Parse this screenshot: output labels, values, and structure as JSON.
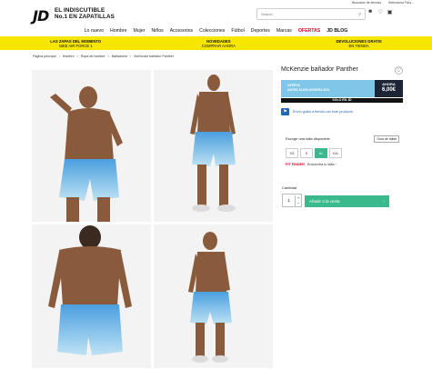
{
  "utility": {
    "links": [
      "Buscador de tiendas",
      "Selecciona País..."
    ]
  },
  "header": {
    "logo": "JD",
    "tagline_line1": "EL INDISCUTIBLE",
    "tagline_line2": "No.1 EN ZAPATILLAS",
    "search_placeholder": "Search",
    "icons": [
      "search-icon",
      "user-icon",
      "heart-icon",
      "bag-icon"
    ]
  },
  "nav": {
    "items": [
      "Lo nuevo",
      "Hombre",
      "Mujer",
      "Niños",
      "Accesorios",
      "Colecciones",
      "Fútbol",
      "Deportes",
      "Marcas"
    ],
    "offer": "OFERTAS",
    "blog": "JD BLOG"
  },
  "promo": [
    {
      "title": "LAS ZAPAS DEL MOMENTO",
      "sub": "NIKE AIR FORCE 1"
    },
    {
      "title": "NOVEDADES",
      "sub": "COMPRAR AHORA"
    },
    {
      "title": "DEVOLUCIONES GRATIS",
      "sub": "EN TIENDA"
    }
  ],
  "breadcrumb": [
    "Página principal",
    "Hombre",
    "Ropa de hombre",
    "Bañadores",
    "McKenzie bañador Panther"
  ],
  "product": {
    "title": "McKenzie bañador Panther",
    "offer_label": "OFERTA",
    "antes": "ANTES 10,00€",
    "ahorra": "AHORRA 40%",
    "now_label": "AHORA",
    "price": "6,00€",
    "solo_en": "SOLO EN JD",
    "shipping": "Envío gratis a tienda con este producto",
    "size_head": "Escoge una talla disponible",
    "size_guide": "Guía de tallas",
    "sizes": [
      "XS",
      "S",
      "XL",
      "XXL"
    ],
    "selected_size": "XL",
    "fit_label": "FIT FINDER",
    "fit_text": "Encuentra tu talla ›",
    "qty_label": "Cantidad",
    "qty_value": "1",
    "add_to_cart": "Añadir a la cesta",
    "add_arrow": "›"
  },
  "colors": {
    "accent": "#39b98c",
    "promo": "#f6e600",
    "price_box": "#7fc6e8",
    "price_now": "#1d2436",
    "offer_red": "#e4002b"
  }
}
